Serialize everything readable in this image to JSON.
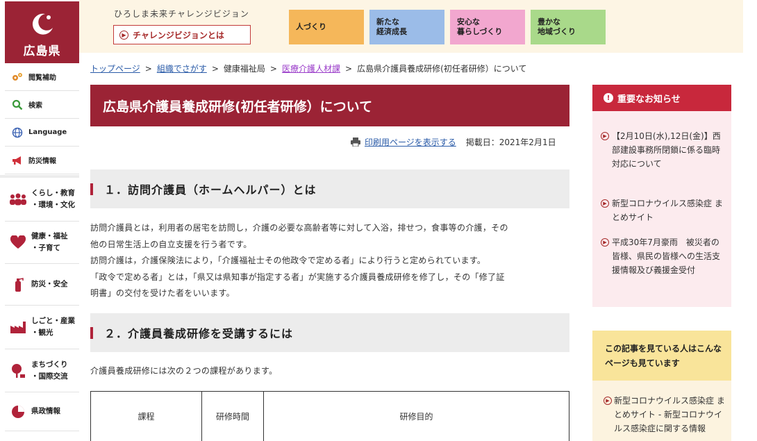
{
  "logo": {
    "name": "広島県"
  },
  "utility": [
    {
      "label": "閲覧補助",
      "icon": "gear-icon"
    },
    {
      "label": "検索",
      "icon": "search-icon"
    },
    {
      "label": "Language",
      "icon": "globe-icon"
    },
    {
      "label": "防災情報",
      "icon": "megaphone-icon"
    }
  ],
  "categories": [
    {
      "line1": "くらし・教育",
      "line2": "・環境・文化",
      "icon": "people-icon"
    },
    {
      "line1": "健康・福祉",
      "line2": "・子育て",
      "icon": "heart-icon"
    },
    {
      "line1": "防災・安全",
      "line2": "",
      "icon": "extinguisher-icon"
    },
    {
      "line1": "しごと・産業",
      "line2": "・観光",
      "icon": "factory-icon"
    },
    {
      "line1": "まちづくり",
      "line2": "・国際交流",
      "icon": "tree-icon"
    },
    {
      "line1": "県政情報",
      "line2": "",
      "icon": "pie-chart-icon"
    }
  ],
  "header": {
    "vision_title": "ひろしま未来チャレンジビジョン",
    "vision_button": "チャレンジビジョンとは",
    "pillars": [
      {
        "line1": "人づくり",
        "line2": "",
        "color": "#f5b75a"
      },
      {
        "line1": "新たな",
        "line2": "経済成長",
        "color": "#9bbce8"
      },
      {
        "line1": "安心な",
        "line2": "暮らしづくり",
        "color": "#f2a7cf"
      },
      {
        "line1": "豊かな",
        "line2": "地域づくり",
        "color": "#a9d98a"
      }
    ]
  },
  "breadcrumb": {
    "top": "トップページ",
    "org": "組織でさがす",
    "bureau": "健康福祉局",
    "section": "医療介護人材課",
    "current": "広島県介護員養成研修(初任者研修）について",
    "sep": ">"
  },
  "page": {
    "title": "広島県介護員養成研修(初任者研修）について",
    "print_link": "印刷用ページを表示する",
    "posted": "掲載日：2021年2月1日",
    "h2_1": "１．訪問介護員（ホームヘルパー）とは",
    "p1": [
      "訪問介護員とは，利用者の居宅を訪問し，介護の必要な高齢者等に対して入浴，排せつ，食事等の介護，その",
      "他の日常生活上の自立支援を行う者です。",
      "訪問介護は，介護保険法により，「介護福祉士その他政令で定める者」により行うと定められています。",
      "「政令で定める者」とは，「県又は県知事が指定する者」が実施する介護員養成研修を修了し，その「修了証",
      "明書」の交付を受けた者をいいます。"
    ],
    "h2_2": "２．介護員養成研修を受講するには",
    "p2": "介護員養成研修には次の２つの課程があります。",
    "table_headers": [
      "課程",
      "研修時間",
      "研修目的"
    ]
  },
  "notice": {
    "title": "重要なお知らせ",
    "items": [
      {
        "text": "【2月10日(水),12日(金)】西部建設事務所閉鎖に係る臨時対応について"
      },
      {
        "text": "新型コロナウイルス感染症 まとめサイト"
      },
      {
        "text": "平成30年7月豪雨　被災者の皆様、県民の皆様への生活支援情報及び義援金受付"
      }
    ]
  },
  "related": {
    "title": "この記事を見ている人はこんなページも見ています",
    "items": [
      {
        "text": "新型コロナウイルス感染症 まとめサイト - 新型コロナウイルス感染症に関する情報"
      }
    ]
  },
  "colors": {
    "brand": "#9b2335",
    "notice": "#c8283c"
  }
}
